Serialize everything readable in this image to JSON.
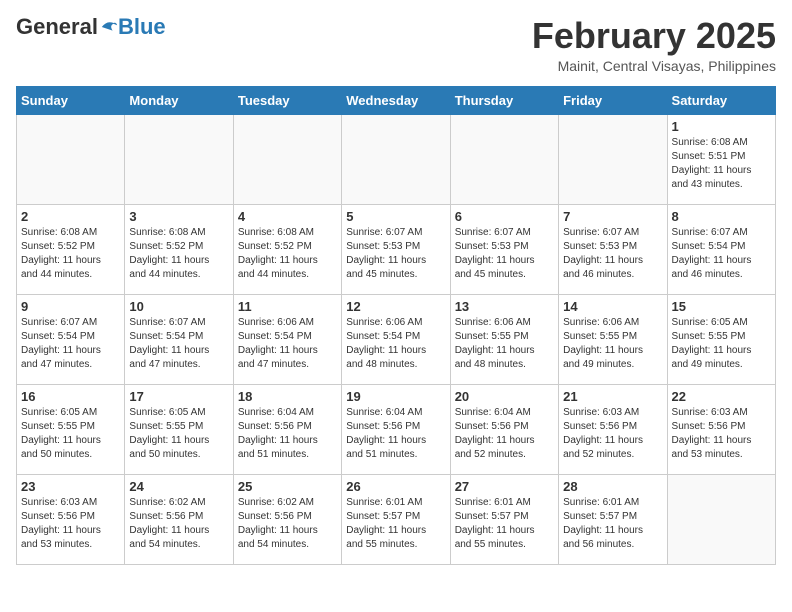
{
  "header": {
    "logo_general": "General",
    "logo_blue": "Blue",
    "month_year": "February 2025",
    "location": "Mainit, Central Visayas, Philippines"
  },
  "weekdays": [
    "Sunday",
    "Monday",
    "Tuesday",
    "Wednesday",
    "Thursday",
    "Friday",
    "Saturday"
  ],
  "weeks": [
    [
      {
        "day": "",
        "info": ""
      },
      {
        "day": "",
        "info": ""
      },
      {
        "day": "",
        "info": ""
      },
      {
        "day": "",
        "info": ""
      },
      {
        "day": "",
        "info": ""
      },
      {
        "day": "",
        "info": ""
      },
      {
        "day": "1",
        "info": "Sunrise: 6:08 AM\nSunset: 5:51 PM\nDaylight: 11 hours\nand 43 minutes."
      }
    ],
    [
      {
        "day": "2",
        "info": "Sunrise: 6:08 AM\nSunset: 5:52 PM\nDaylight: 11 hours\nand 44 minutes."
      },
      {
        "day": "3",
        "info": "Sunrise: 6:08 AM\nSunset: 5:52 PM\nDaylight: 11 hours\nand 44 minutes."
      },
      {
        "day": "4",
        "info": "Sunrise: 6:08 AM\nSunset: 5:52 PM\nDaylight: 11 hours\nand 44 minutes."
      },
      {
        "day": "5",
        "info": "Sunrise: 6:07 AM\nSunset: 5:53 PM\nDaylight: 11 hours\nand 45 minutes."
      },
      {
        "day": "6",
        "info": "Sunrise: 6:07 AM\nSunset: 5:53 PM\nDaylight: 11 hours\nand 45 minutes."
      },
      {
        "day": "7",
        "info": "Sunrise: 6:07 AM\nSunset: 5:53 PM\nDaylight: 11 hours\nand 46 minutes."
      },
      {
        "day": "8",
        "info": "Sunrise: 6:07 AM\nSunset: 5:54 PM\nDaylight: 11 hours\nand 46 minutes."
      }
    ],
    [
      {
        "day": "9",
        "info": "Sunrise: 6:07 AM\nSunset: 5:54 PM\nDaylight: 11 hours\nand 47 minutes."
      },
      {
        "day": "10",
        "info": "Sunrise: 6:07 AM\nSunset: 5:54 PM\nDaylight: 11 hours\nand 47 minutes."
      },
      {
        "day": "11",
        "info": "Sunrise: 6:06 AM\nSunset: 5:54 PM\nDaylight: 11 hours\nand 47 minutes."
      },
      {
        "day": "12",
        "info": "Sunrise: 6:06 AM\nSunset: 5:54 PM\nDaylight: 11 hours\nand 48 minutes."
      },
      {
        "day": "13",
        "info": "Sunrise: 6:06 AM\nSunset: 5:55 PM\nDaylight: 11 hours\nand 48 minutes."
      },
      {
        "day": "14",
        "info": "Sunrise: 6:06 AM\nSunset: 5:55 PM\nDaylight: 11 hours\nand 49 minutes."
      },
      {
        "day": "15",
        "info": "Sunrise: 6:05 AM\nSunset: 5:55 PM\nDaylight: 11 hours\nand 49 minutes."
      }
    ],
    [
      {
        "day": "16",
        "info": "Sunrise: 6:05 AM\nSunset: 5:55 PM\nDaylight: 11 hours\nand 50 minutes."
      },
      {
        "day": "17",
        "info": "Sunrise: 6:05 AM\nSunset: 5:55 PM\nDaylight: 11 hours\nand 50 minutes."
      },
      {
        "day": "18",
        "info": "Sunrise: 6:04 AM\nSunset: 5:56 PM\nDaylight: 11 hours\nand 51 minutes."
      },
      {
        "day": "19",
        "info": "Sunrise: 6:04 AM\nSunset: 5:56 PM\nDaylight: 11 hours\nand 51 minutes."
      },
      {
        "day": "20",
        "info": "Sunrise: 6:04 AM\nSunset: 5:56 PM\nDaylight: 11 hours\nand 52 minutes."
      },
      {
        "day": "21",
        "info": "Sunrise: 6:03 AM\nSunset: 5:56 PM\nDaylight: 11 hours\nand 52 minutes."
      },
      {
        "day": "22",
        "info": "Sunrise: 6:03 AM\nSunset: 5:56 PM\nDaylight: 11 hours\nand 53 minutes."
      }
    ],
    [
      {
        "day": "23",
        "info": "Sunrise: 6:03 AM\nSunset: 5:56 PM\nDaylight: 11 hours\nand 53 minutes."
      },
      {
        "day": "24",
        "info": "Sunrise: 6:02 AM\nSunset: 5:56 PM\nDaylight: 11 hours\nand 54 minutes."
      },
      {
        "day": "25",
        "info": "Sunrise: 6:02 AM\nSunset: 5:56 PM\nDaylight: 11 hours\nand 54 minutes."
      },
      {
        "day": "26",
        "info": "Sunrise: 6:01 AM\nSunset: 5:57 PM\nDaylight: 11 hours\nand 55 minutes."
      },
      {
        "day": "27",
        "info": "Sunrise: 6:01 AM\nSunset: 5:57 PM\nDaylight: 11 hours\nand 55 minutes."
      },
      {
        "day": "28",
        "info": "Sunrise: 6:01 AM\nSunset: 5:57 PM\nDaylight: 11 hours\nand 56 minutes."
      },
      {
        "day": "",
        "info": ""
      }
    ]
  ]
}
